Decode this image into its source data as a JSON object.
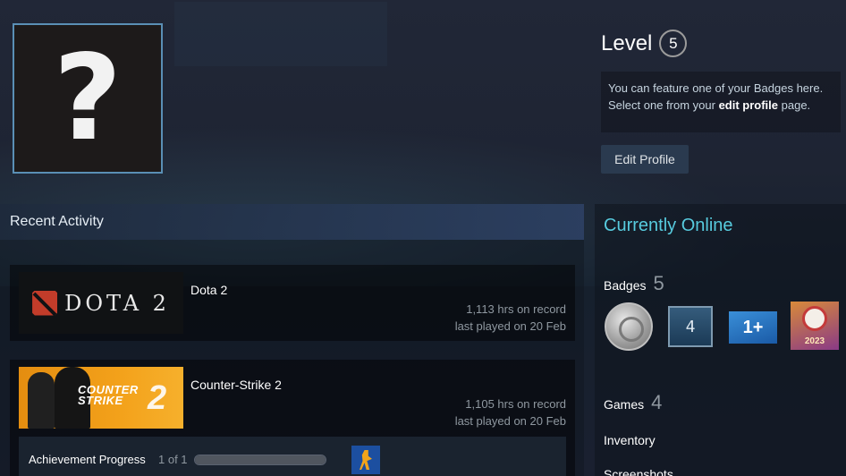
{
  "profile": {
    "avatar_placeholder": "?",
    "level_label": "Level",
    "level_value": "5",
    "badge_message_prefix": "You can feature one of your Badges here. Select one from your ",
    "badge_message_link": "edit profile",
    "badge_message_suffix": " page.",
    "edit_button": "Edit Profile"
  },
  "activity": {
    "header": "Recent Activity",
    "games": [
      {
        "name": "Dota 2",
        "capsule_text": "DOTA 2",
        "hours": "1,113 hrs on record",
        "last_played": "last played on 20 Feb"
      },
      {
        "name": "Counter-Strike 2",
        "capsule_text_line1": "COUNTER",
        "capsule_text_line2": "STRIKE",
        "capsule_number": "2",
        "hours": "1,105 hrs on record",
        "last_played": "last played on 20 Feb",
        "achievement_label": "Achievement Progress",
        "achievement_count": "1 of 1",
        "achievement_progress": 1.0
      }
    ]
  },
  "sidebar": {
    "status": "Currently Online",
    "badges_label": "Badges",
    "badges_count": "5",
    "badge_icons": [
      "coin-badge-icon",
      "level-4-badge-icon",
      "one-plus-badge-icon",
      "steam-2023-badge-icon"
    ],
    "badge_level_text": "4",
    "badge_plus_text": "1+",
    "badge_year_text": "2023",
    "games_label": "Games",
    "games_count": "4",
    "inventory_label": "Inventory",
    "screenshots_label": "Screenshots"
  },
  "colors": {
    "accent_online": "#57cbde",
    "button_bg": "#2a3a4f",
    "avatar_border": "#5a8fb5"
  }
}
